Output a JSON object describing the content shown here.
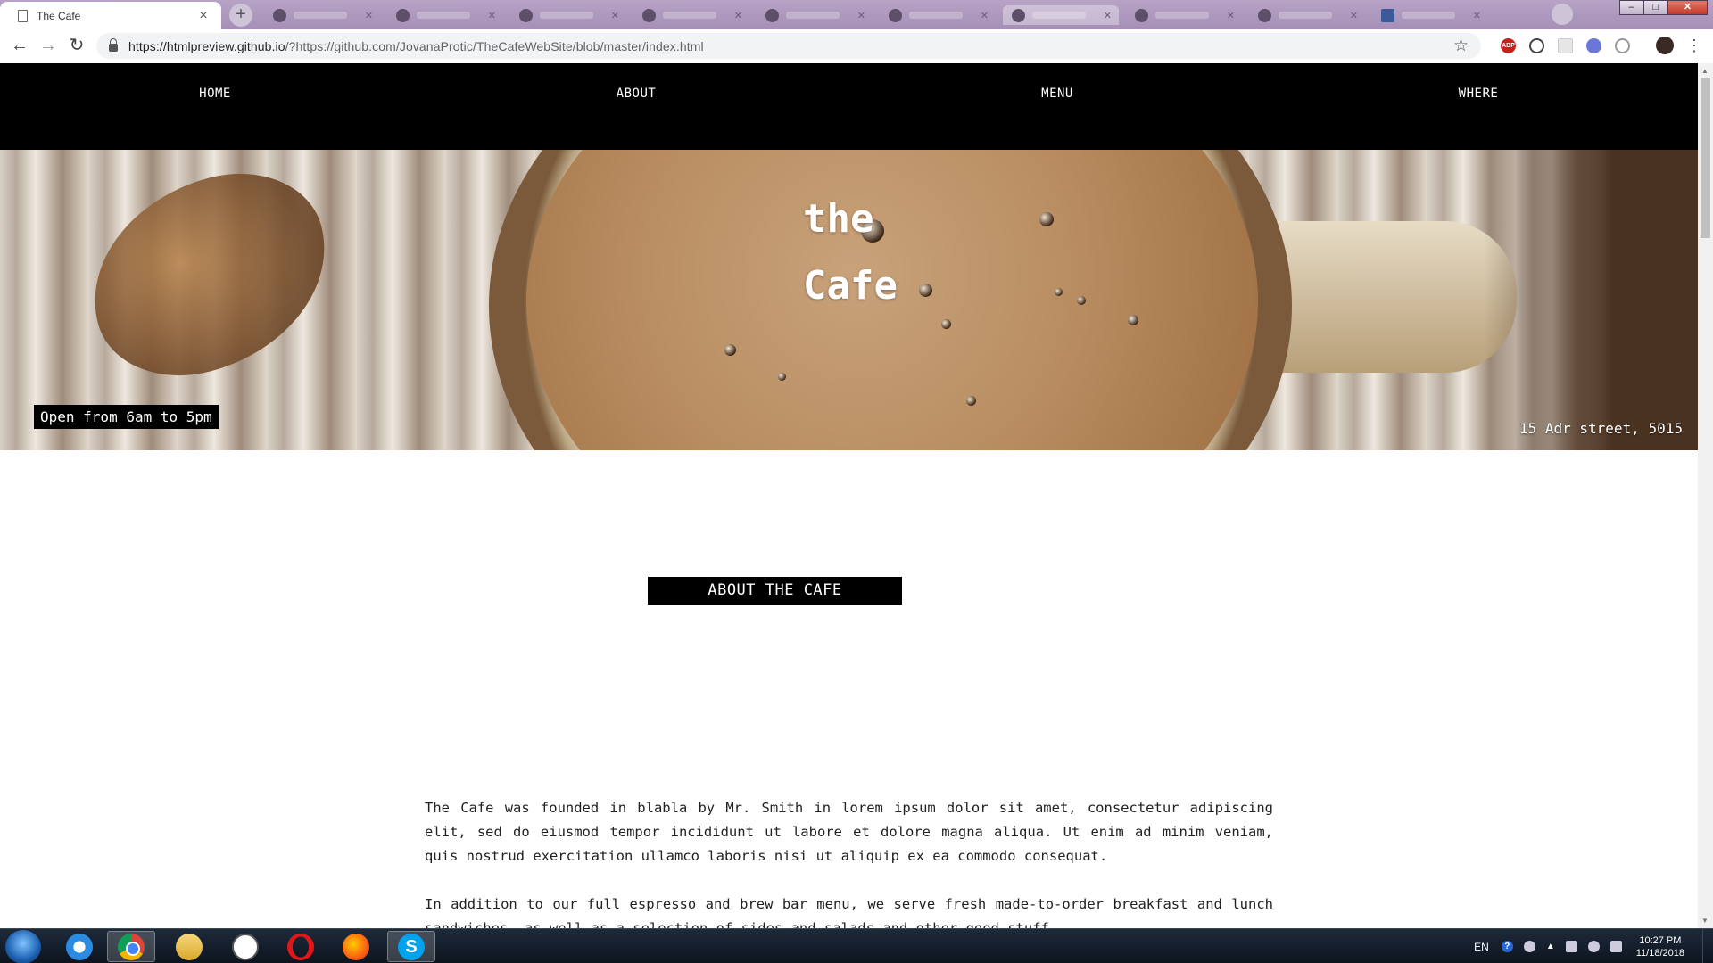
{
  "browser": {
    "tab_title": "The Cafe",
    "tab_close": "×",
    "new_tab": "+",
    "url_host": "https://htmlpreview.github.io",
    "url_rest": "/?https://github.com/JovanaProtic/TheCafeWebSite/blob/master/index.html",
    "back": "←",
    "forward": "→",
    "reload": "↻",
    "bookmark": "☆",
    "ext_abp": "ABP",
    "menu": "⋮",
    "window_controls": {
      "minimize": "–",
      "maximize": "□",
      "close": "✕"
    }
  },
  "site": {
    "nav": [
      "HOME",
      "ABOUT",
      "MENU",
      "WHERE"
    ],
    "hero": {
      "title_line1": "the",
      "title_line2": "Cafe",
      "hours": "Open from 6am to 5pm",
      "address": "15 Adr street, 5015"
    },
    "about": {
      "heading": "ABOUT THE CAFE",
      "paragraphs": [
        "The Cafe was founded in blabla by Mr. Smith in lorem ipsum dolor sit amet, consectetur adipiscing elit, sed do eiusmod tempor incididunt ut labore et dolore magna aliqua. Ut enim ad minim veniam, quis nostrud exercitation ullamco laboris nisi ut aliquip ex ea commodo consequat.",
        "In addition to our full espresso and brew bar menu, we serve fresh made-to-order breakfast and lunch sandwiches, as well as a selection of sides and salads and other good stuff."
      ]
    }
  },
  "taskbar": {
    "language": "EN",
    "help": "?",
    "tray_arrow": "▲",
    "time": "10:27 PM",
    "date": "11/18/2018",
    "skype_letter": "S"
  },
  "icons": {
    "tab_page": "page-icon",
    "lock": "lock-icon",
    "star": "star-icon",
    "start": "windows-start-icon"
  }
}
